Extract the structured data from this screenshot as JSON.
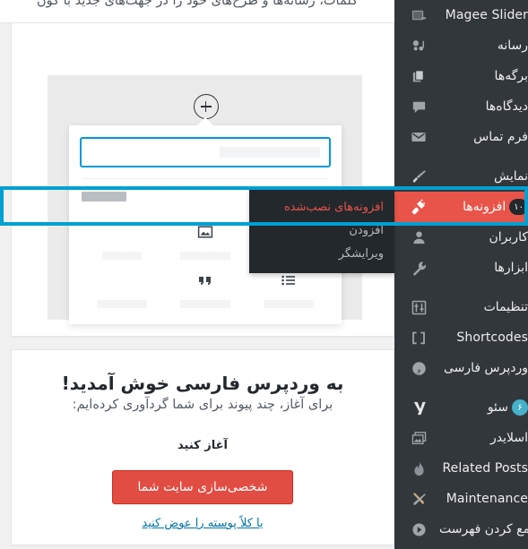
{
  "content": {
    "truncated_notice": "کلمات، رسانه‌ها و طرح‌های خود را در جهت‌های جدید با کون"
  },
  "editor_preview": {
    "add_block_icon": "plus-circle-icon",
    "inserter": {
      "search_placeholder": "",
      "category_label": "",
      "collapse_icon": "chevron-up-icon",
      "blocks": [
        {
          "icon": "paragraph-icon",
          "label": ""
        },
        {
          "icon": "image-icon",
          "label": ""
        },
        {
          "icon": "heading-icon",
          "label": ""
        },
        {
          "icon": "list-icon",
          "label": ""
        },
        {
          "icon": "quote-icon",
          "label": ""
        },
        {
          "icon": "gallery-icon",
          "label": ""
        }
      ]
    }
  },
  "welcome_panel": {
    "title": "به وردپرس فارسی خوش آمدید!",
    "subtitle": "برای آغاز، چند پیوند برای شما گردآوری کرده‌ایم:",
    "section_heading": "آغاز کنید",
    "primary_button": "شخصی‌سازی سایت شما",
    "secondary_link": "یا کلاً پوسته را عوض کنید"
  },
  "admin_menu": {
    "items": [
      {
        "label": "Magee Slider",
        "icon": "slider-image-icon",
        "badge": null,
        "current": false,
        "ltr": true
      },
      {
        "label": "رسانه",
        "icon": "media-icon",
        "badge": null,
        "current": false
      },
      {
        "label": "برگه‌ها",
        "icon": "pages-icon",
        "badge": null,
        "current": false
      },
      {
        "label": "دیدگاه‌ها",
        "icon": "comments-icon",
        "badge": null,
        "current": false
      },
      {
        "label": "فرم تماس",
        "icon": "mail-icon",
        "badge": null,
        "current": false
      },
      {
        "label": "نمایش",
        "icon": "appearance-brush-icon",
        "badge": null,
        "current": false,
        "gap_before": true
      },
      {
        "label": "افزونه‌ها",
        "icon": "plugins-plug-icon",
        "badge": "۱۰",
        "current": true
      },
      {
        "label": "کاربران",
        "icon": "users-icon",
        "badge": null,
        "current": false
      },
      {
        "label": "ابزارها",
        "icon": "tools-wrench-icon",
        "badge": null,
        "current": false
      },
      {
        "label": "تنظیمات",
        "icon": "settings-sliders-icon",
        "badge": null,
        "current": false,
        "gap_before": true
      },
      {
        "label": "Shortcodes",
        "icon": "shortcodes-brackets-icon",
        "badge": null,
        "current": false,
        "ltr": true
      },
      {
        "label": "وردپرس فارسی",
        "icon": "wp-farsi-icon",
        "badge": null,
        "current": false
      },
      {
        "label": "سئو",
        "icon": "yoast-seo-icon",
        "badge": "۶",
        "badge_style": "seo",
        "current": false,
        "gap_before": true
      },
      {
        "label": "اسلایدر",
        "icon": "slider-gallery-icon",
        "badge": null,
        "current": false
      },
      {
        "label": "Related Posts",
        "icon": "flame-icon",
        "badge": null,
        "current": false,
        "ltr": true
      },
      {
        "label": "Maintenance",
        "icon": "maintenance-tools-icon",
        "badge": null,
        "current": false,
        "ltr": true
      },
      {
        "label": "جمع کردن فهرست",
        "icon": "collapse-arrow-icon",
        "badge": null,
        "current": false
      }
    ]
  },
  "plugins_submenu": {
    "items": [
      {
        "label": "افزونه‌های نصب‌شده",
        "current": true
      },
      {
        "label": "افزودن",
        "current": false
      },
      {
        "label": "ویرایشگر",
        "current": false
      }
    ]
  },
  "colors": {
    "menu_bg": "#32373c",
    "submenu_bg": "#23282d",
    "current_item": "#e8544a",
    "highlight_border": "#00a0d2",
    "accent_blue": "#0099d8",
    "button_red": "#e14d43",
    "link_blue": "#0073aa",
    "seo_badge": "#46b1c9"
  }
}
